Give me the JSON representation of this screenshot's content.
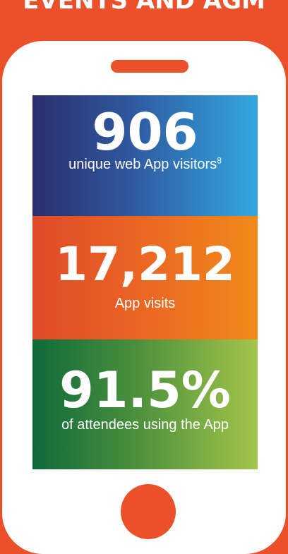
{
  "header": {
    "title": "EVENTS AND AGM"
  },
  "stats": [
    {
      "value": "906",
      "label": "unique web App visitors",
      "footnote": "8"
    },
    {
      "value": "17,212",
      "label": "App visits"
    },
    {
      "value": "91.5%",
      "label": "of attendees using the App"
    }
  ],
  "colors": {
    "background": "#ea5029",
    "phone_body": "#ffffff",
    "panel_visitors": [
      "#2b2e6e",
      "#33a8e0"
    ],
    "panel_visits": [
      "#e04a2a",
      "#f08a1a"
    ],
    "panel_usage": [
      "#0e6a3a",
      "#a3c54a"
    ]
  },
  "icons": {
    "phone": "smartphone-outline",
    "speaker": "speaker-slot",
    "home": "home-button-circle"
  }
}
